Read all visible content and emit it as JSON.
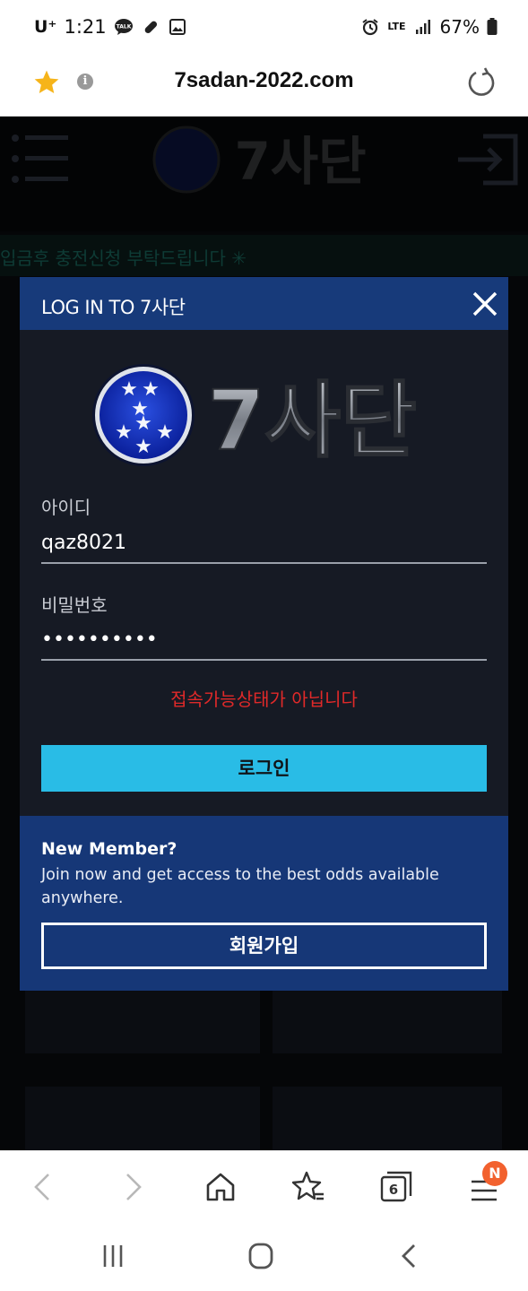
{
  "status_bar": {
    "carrier": "U⁺",
    "time": "1:21",
    "talk_badge": "TALK",
    "network": "LTE",
    "battery": "67%"
  },
  "url_bar": {
    "url": "7sadan-2022.com"
  },
  "background_page": {
    "notice": "입금후 충전신청 부탁드립니다 ✳"
  },
  "modal": {
    "title": "LOG IN TO 7사단",
    "logo_text": "7사단",
    "id_label": "아이디",
    "id_value": "qaz8021",
    "pw_label": "비밀번호",
    "pw_value": "••••••••••",
    "error": "접속가능상태가 아닙니다",
    "login_button": "로그인",
    "new_member_title": "New Member?",
    "new_member_text": "Join now and get access to the best odds available anywhere.",
    "signup_button": "회원가입"
  },
  "toolbar": {
    "tab_count": "6",
    "menu_badge": "N"
  },
  "colors": {
    "header_blue": "#173a7a",
    "login_button": "#29bce6",
    "error_red": "#e02929",
    "badge_orange": "#f2612e"
  },
  "icons": [
    "star-icon",
    "info-icon",
    "reload-icon",
    "close-icon",
    "back-icon",
    "forward-icon",
    "home-icon",
    "bookmarks-icon",
    "tabs-icon",
    "menu-icon",
    "recent-apps-icon",
    "home-nav-icon",
    "back-nav-icon"
  ]
}
